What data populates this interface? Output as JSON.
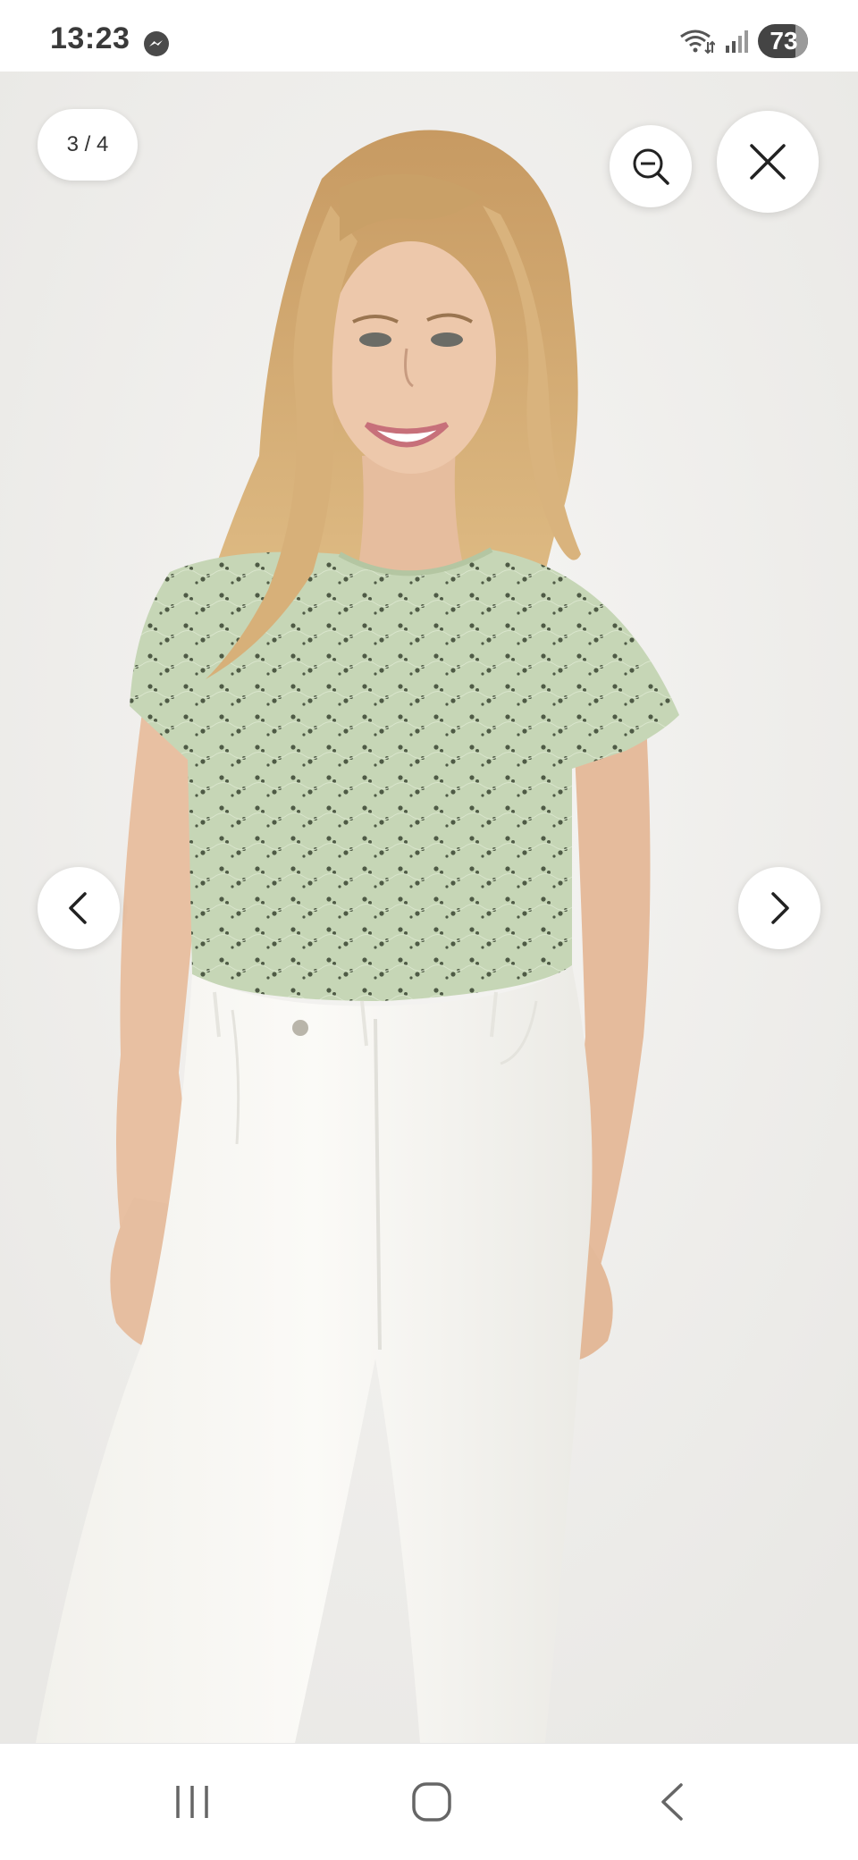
{
  "status_bar": {
    "time": "13:23",
    "notification_icon": "messenger-icon",
    "wifi_icon": "wifi-icon",
    "signal_icon": "signal-icon",
    "battery_level": "73"
  },
  "viewer": {
    "image_counter": "3 / 4",
    "image_description_icon": "product-photo",
    "zoom_button_icon": "zoom-out-icon",
    "close_button_icon": "close-icon",
    "prev_button_icon": "chevron-left-icon",
    "next_button_icon": "chevron-right-icon"
  },
  "nav_bar": {
    "recents_icon": "recents-icon",
    "home_icon": "home-icon",
    "back_icon": "back-icon"
  },
  "colors": {
    "background": "#f0efed",
    "top_color": "#c4d4b4",
    "pants_color": "#f7f6f2",
    "hair_color": "#d6ae78",
    "skin_color": "#e8c0a2"
  }
}
